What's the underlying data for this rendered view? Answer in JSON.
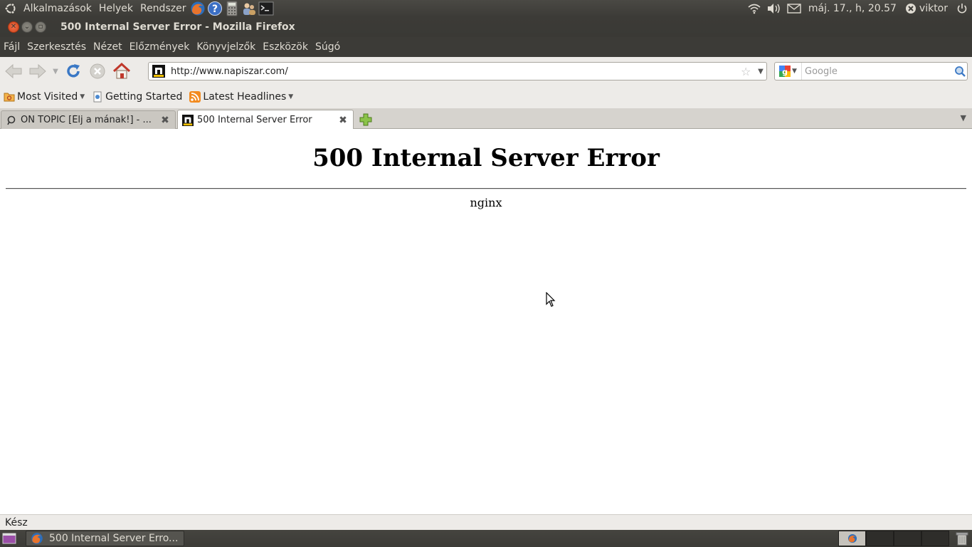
{
  "top_panel": {
    "menus": [
      "Alkalmazások",
      "Helyek",
      "Rendszer"
    ],
    "clock": "máj. 17., h, 20.57",
    "user": "viktor"
  },
  "window": {
    "title": "500 Internal Server Error - Mozilla Firefox"
  },
  "menubar": {
    "items": [
      "Fájl",
      "Szerkesztés",
      "Nézet",
      "Előzmények",
      "Könyvjelzők",
      "Eszközök",
      "Súgó"
    ]
  },
  "navbar": {
    "url": "http://www.napiszar.com/",
    "search_placeholder": "Google"
  },
  "bookmarks": {
    "items": [
      "Most Visited",
      "Getting Started",
      "Latest Headlines"
    ]
  },
  "tabs": [
    {
      "label": "ON TOPIC [Élj a mának!] - ...",
      "active": false
    },
    {
      "label": "500 Internal Server Error",
      "active": true
    }
  ],
  "page": {
    "heading": "500 Internal Server Error",
    "server": "nginx"
  },
  "statusbar": {
    "text": "Kész"
  },
  "bottom_panel": {
    "task_label": "500 Internal Server Erro..."
  },
  "colors": {
    "panel_bg": "#3c3b37",
    "toolbar_bg": "#edebe8",
    "accent_orange": "#f07746"
  }
}
